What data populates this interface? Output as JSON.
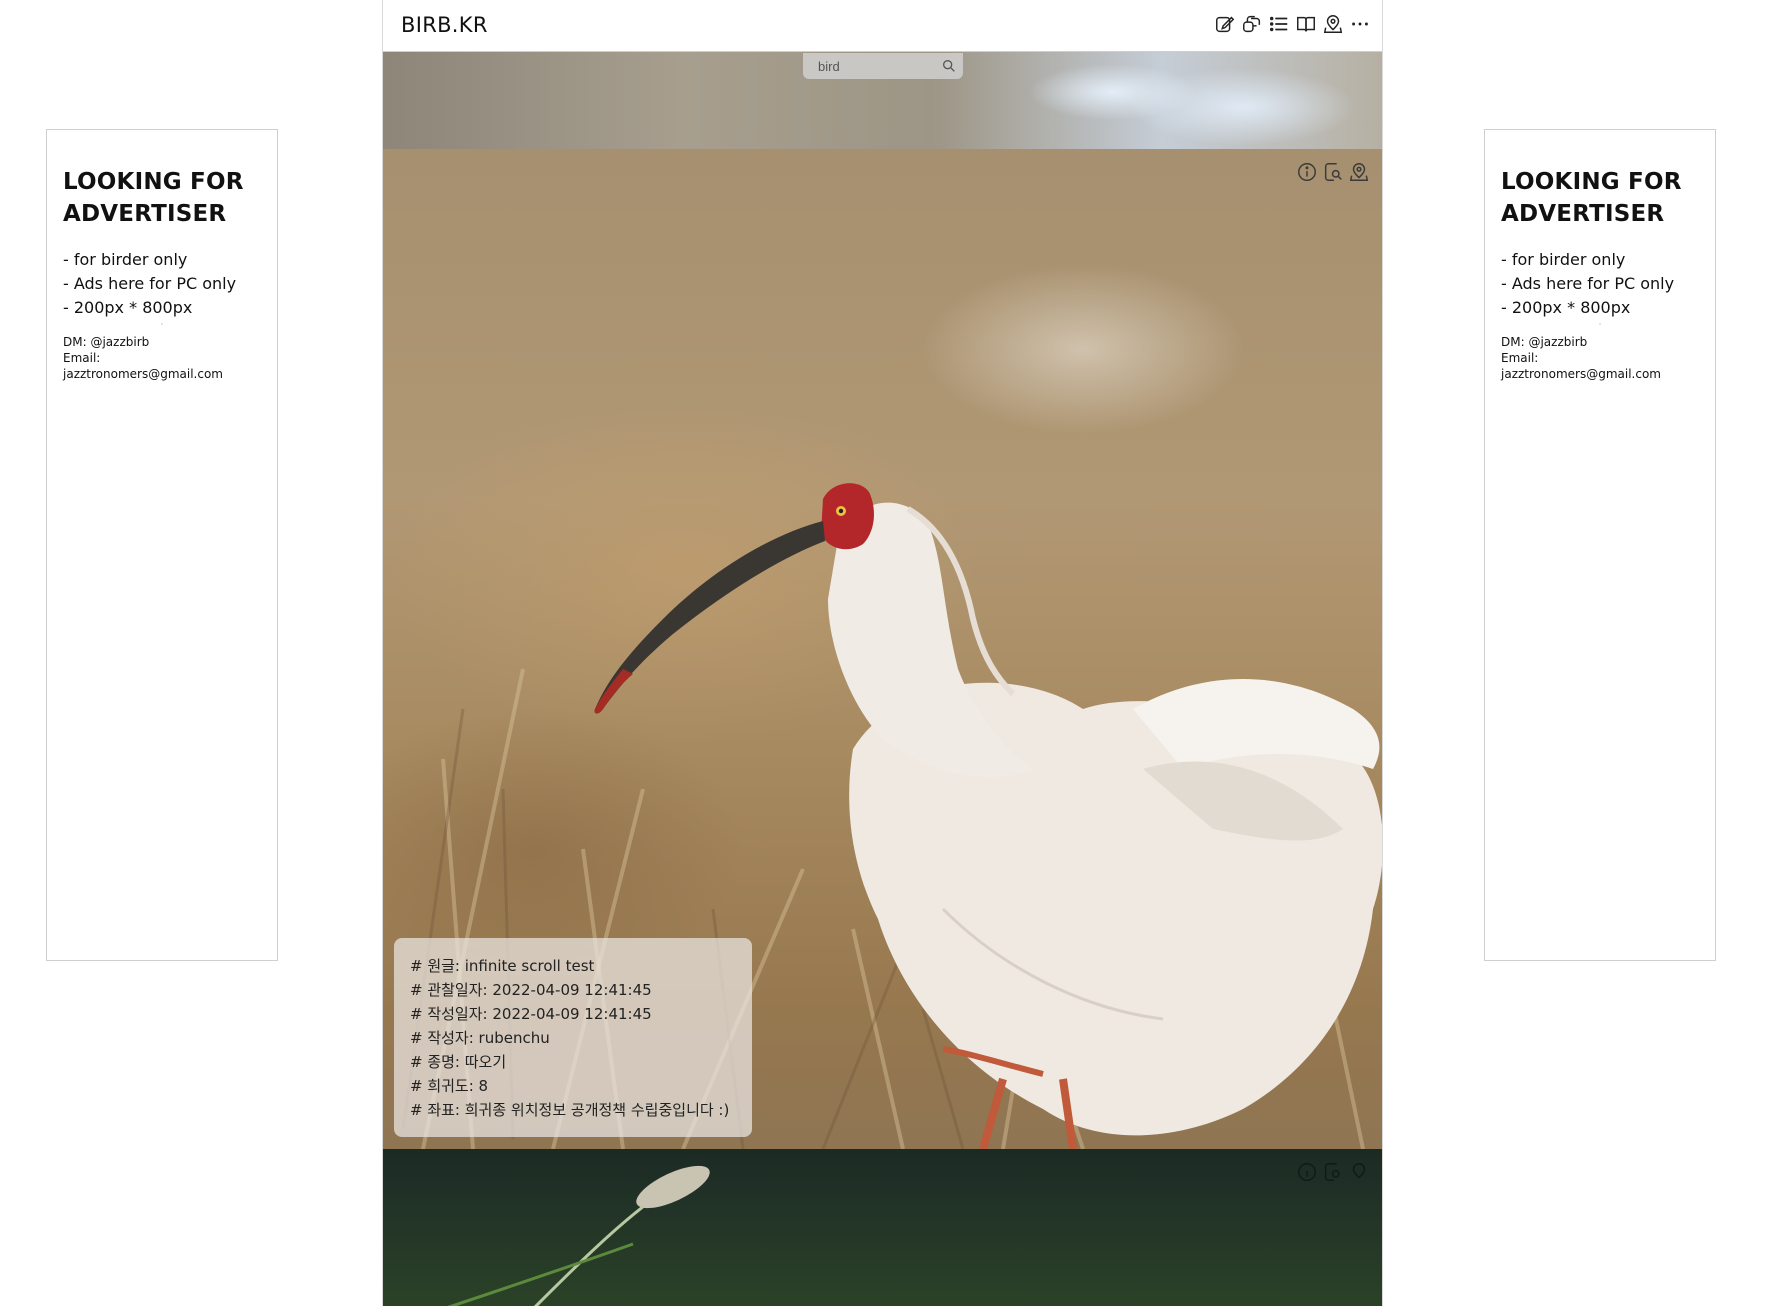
{
  "header": {
    "brand": "BIRB.KR",
    "toolbar": [
      {
        "name": "edit-icon"
      },
      {
        "name": "gallery-icon"
      },
      {
        "name": "list-icon"
      },
      {
        "name": "book-icon"
      },
      {
        "name": "map-pin-icon"
      },
      {
        "name": "more-icon"
      }
    ]
  },
  "search": {
    "value": "bird"
  },
  "ads": {
    "title": "LOOKING FOR ADVERTISER",
    "lines": [
      "- for birder only",
      "- Ads here for PC only",
      "- 200px * 800px"
    ],
    "dot": "·",
    "dm": "DM: @jazzbirb",
    "email": "Email: jazztronomers@gmail.com"
  },
  "post": {
    "actions": [
      "info-icon",
      "search-doc-icon",
      "map-pin-icon"
    ],
    "info": [
      "# 원글: infinite scroll test",
      "# 관찰일자: 2022-04-09 12:41:45",
      "# 작성일자: 2022-04-09 12:41:45",
      "# 작성자: rubenchu",
      "# 종명: 따오기",
      "# 희귀도: 8",
      "# 좌표: 희귀종 위치정보 공개정책 수립중입니다 :)"
    ]
  },
  "colors": {
    "ad_border": "#cfcfcf",
    "bird_head": "#b3262a",
    "bird_body": "#f1ece6"
  }
}
